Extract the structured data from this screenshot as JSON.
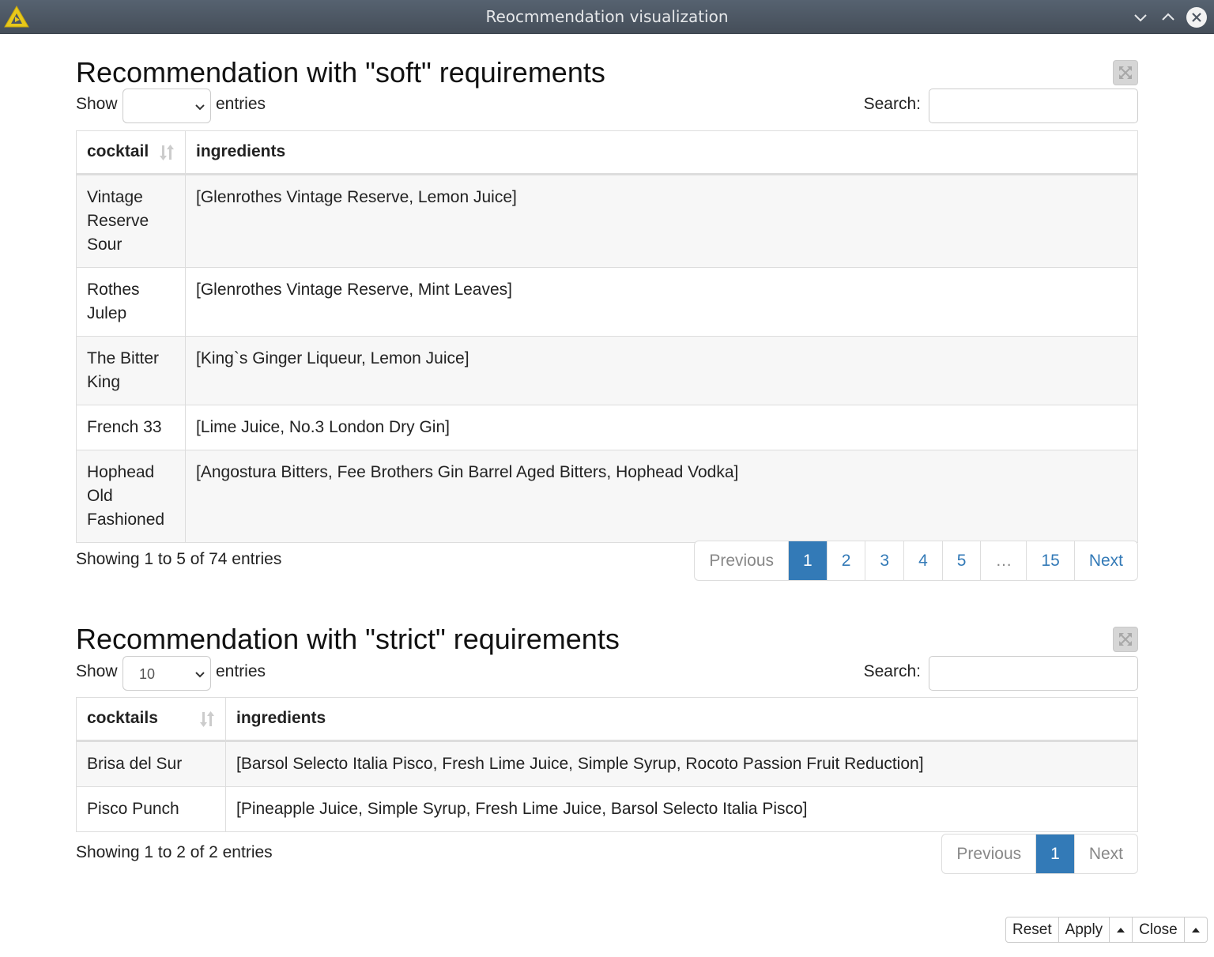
{
  "window": {
    "title": "Reocmmendation visualization",
    "controls": [
      "minimize",
      "maximize",
      "close"
    ]
  },
  "soft": {
    "heading": "Recommendation with \"soft\" requirements",
    "show_label": "Show",
    "entries_label": "entries",
    "page_length": "",
    "search_label": "Search:",
    "search_value": "",
    "columns": [
      "cocktail",
      "ingredients"
    ],
    "rows": [
      {
        "cocktail": "Vintage Reserve Sour",
        "ingredients": "[Glenrothes Vintage Reserve, Lemon Juice]"
      },
      {
        "cocktail": "Rothes Julep",
        "ingredients": "[Glenrothes Vintage Reserve, Mint Leaves]"
      },
      {
        "cocktail": "The Bitter King",
        "ingredients": "[King`s Ginger Liqueur, Lemon Juice]"
      },
      {
        "cocktail": "French 33",
        "ingredients": "[Lime Juice, No.3 London Dry Gin]"
      },
      {
        "cocktail": "Hophead Old Fashioned",
        "ingredients": "[Angostura Bitters, Fee Brothers Gin Barrel Aged Bitters, Hophead Vodka]"
      }
    ],
    "info": "Showing 1 to 5 of 74 entries",
    "pagination": {
      "previous": "Previous",
      "pages": [
        "1",
        "2",
        "3",
        "4",
        "5",
        "…",
        "15"
      ],
      "active": "1",
      "next": "Next"
    }
  },
  "strict": {
    "heading": "Recommendation with \"strict\" requirements",
    "show_label": "Show",
    "entries_label": "entries",
    "page_length": "10",
    "search_label": "Search:",
    "search_value": "",
    "columns": [
      "cocktails",
      "ingredients"
    ],
    "rows": [
      {
        "cocktail": "Brisa del Sur",
        "ingredients": "[Barsol Selecto Italia Pisco, Fresh Lime Juice, Simple Syrup, Rocoto Passion Fruit Reduction]"
      },
      {
        "cocktail": "Pisco Punch",
        "ingredients": "[Pineapple Juice, Simple Syrup, Fresh Lime Juice, Barsol Selecto Italia Pisco]"
      }
    ],
    "info": "Showing 1 to 2 of 2 entries",
    "pagination": {
      "previous": "Previous",
      "pages": [
        "1"
      ],
      "active": "1",
      "next": "Next"
    }
  },
  "footer": {
    "reset": "Reset",
    "apply": "Apply",
    "close": "Close"
  },
  "colors": {
    "accent": "#337ab7",
    "titlebar": "#4d5662",
    "logo": "#e8c81a"
  }
}
